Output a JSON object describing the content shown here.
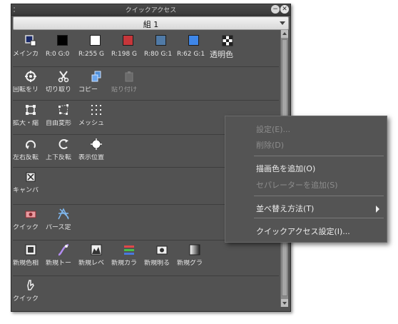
{
  "window": {
    "title": "クイックアクセス",
    "min_glyph": "−",
    "close_glyph": "✕"
  },
  "set_selector": {
    "value": "組 1"
  },
  "groups": [
    {
      "items": [
        {
          "label": "メインカ",
          "icon": "main-color-icon"
        },
        {
          "label": "R:0 G:0",
          "swatch": "#000000"
        },
        {
          "label": "R:255 G",
          "swatch": "#ffffff"
        },
        {
          "label": "R:198 G",
          "swatch": "#c6363a"
        },
        {
          "label": "R:80 G:1",
          "swatch": "#507aa6"
        },
        {
          "label": "R:62 G:1",
          "swatch": "#3e86e8"
        },
        {
          "label": "透明色",
          "icon": "transparent-checker-icon"
        }
      ]
    },
    {
      "items": [
        {
          "label": "回転をリ",
          "icon": "reset-rotation-icon"
        },
        {
          "label": "切り取り",
          "icon": "scissors-icon"
        },
        {
          "label": "コピー",
          "icon": "copy-icon"
        },
        {
          "label": "貼り付け",
          "icon": "paste-icon",
          "dim": true
        }
      ]
    },
    {
      "items": [
        {
          "label": "拡大・縮",
          "icon": "scale-icon"
        },
        {
          "label": "自由変形",
          "icon": "free-transform-icon"
        },
        {
          "label": "メッシュ",
          "icon": "mesh-transform-icon"
        }
      ]
    },
    {
      "items": [
        {
          "label": "左右反転",
          "icon": "flip-horizontal-icon"
        },
        {
          "label": "上下反転",
          "icon": "flip-vertical-icon"
        },
        {
          "label": "表示位置",
          "icon": "display-position-icon"
        }
      ]
    },
    {
      "items": [
        {
          "label": "キャンバ",
          "icon": "canvas-icon"
        }
      ]
    },
    {
      "items": [
        {
          "label": "クイック",
          "icon": "quick-mask-icon"
        },
        {
          "label": "パース定",
          "icon": "perspective-ruler-icon"
        }
      ]
    },
    {
      "items": [
        {
          "label": "新規色相",
          "icon": "new-hue-layer-icon"
        },
        {
          "label": "新規トー",
          "icon": "new-tone-curve-layer-icon"
        },
        {
          "label": "新規レベ",
          "icon": "new-level-layer-icon"
        },
        {
          "label": "新規カラ",
          "icon": "new-color-balance-layer-icon"
        },
        {
          "label": "新規明る",
          "icon": "new-brightness-layer-icon"
        },
        {
          "label": "新規グラ",
          "icon": "new-gradient-map-layer-icon"
        }
      ]
    },
    {
      "items": [
        {
          "label": "クイック",
          "icon": "quick-access-hand-icon"
        }
      ]
    }
  ],
  "context_menu": {
    "items": [
      {
        "label": "設定(E)...",
        "disabled": true
      },
      {
        "label": "削除(D)",
        "disabled": true
      },
      {
        "separator": true
      },
      {
        "label": "描画色を追加(O)",
        "disabled": false
      },
      {
        "label": "セパレーターを追加(S)",
        "disabled": true
      },
      {
        "separator": true
      },
      {
        "label": "並べ替え方法(T)",
        "disabled": false,
        "submenu": true
      },
      {
        "separator": true
      },
      {
        "label": "クイックアクセス設定(I)...",
        "disabled": false
      }
    ]
  }
}
